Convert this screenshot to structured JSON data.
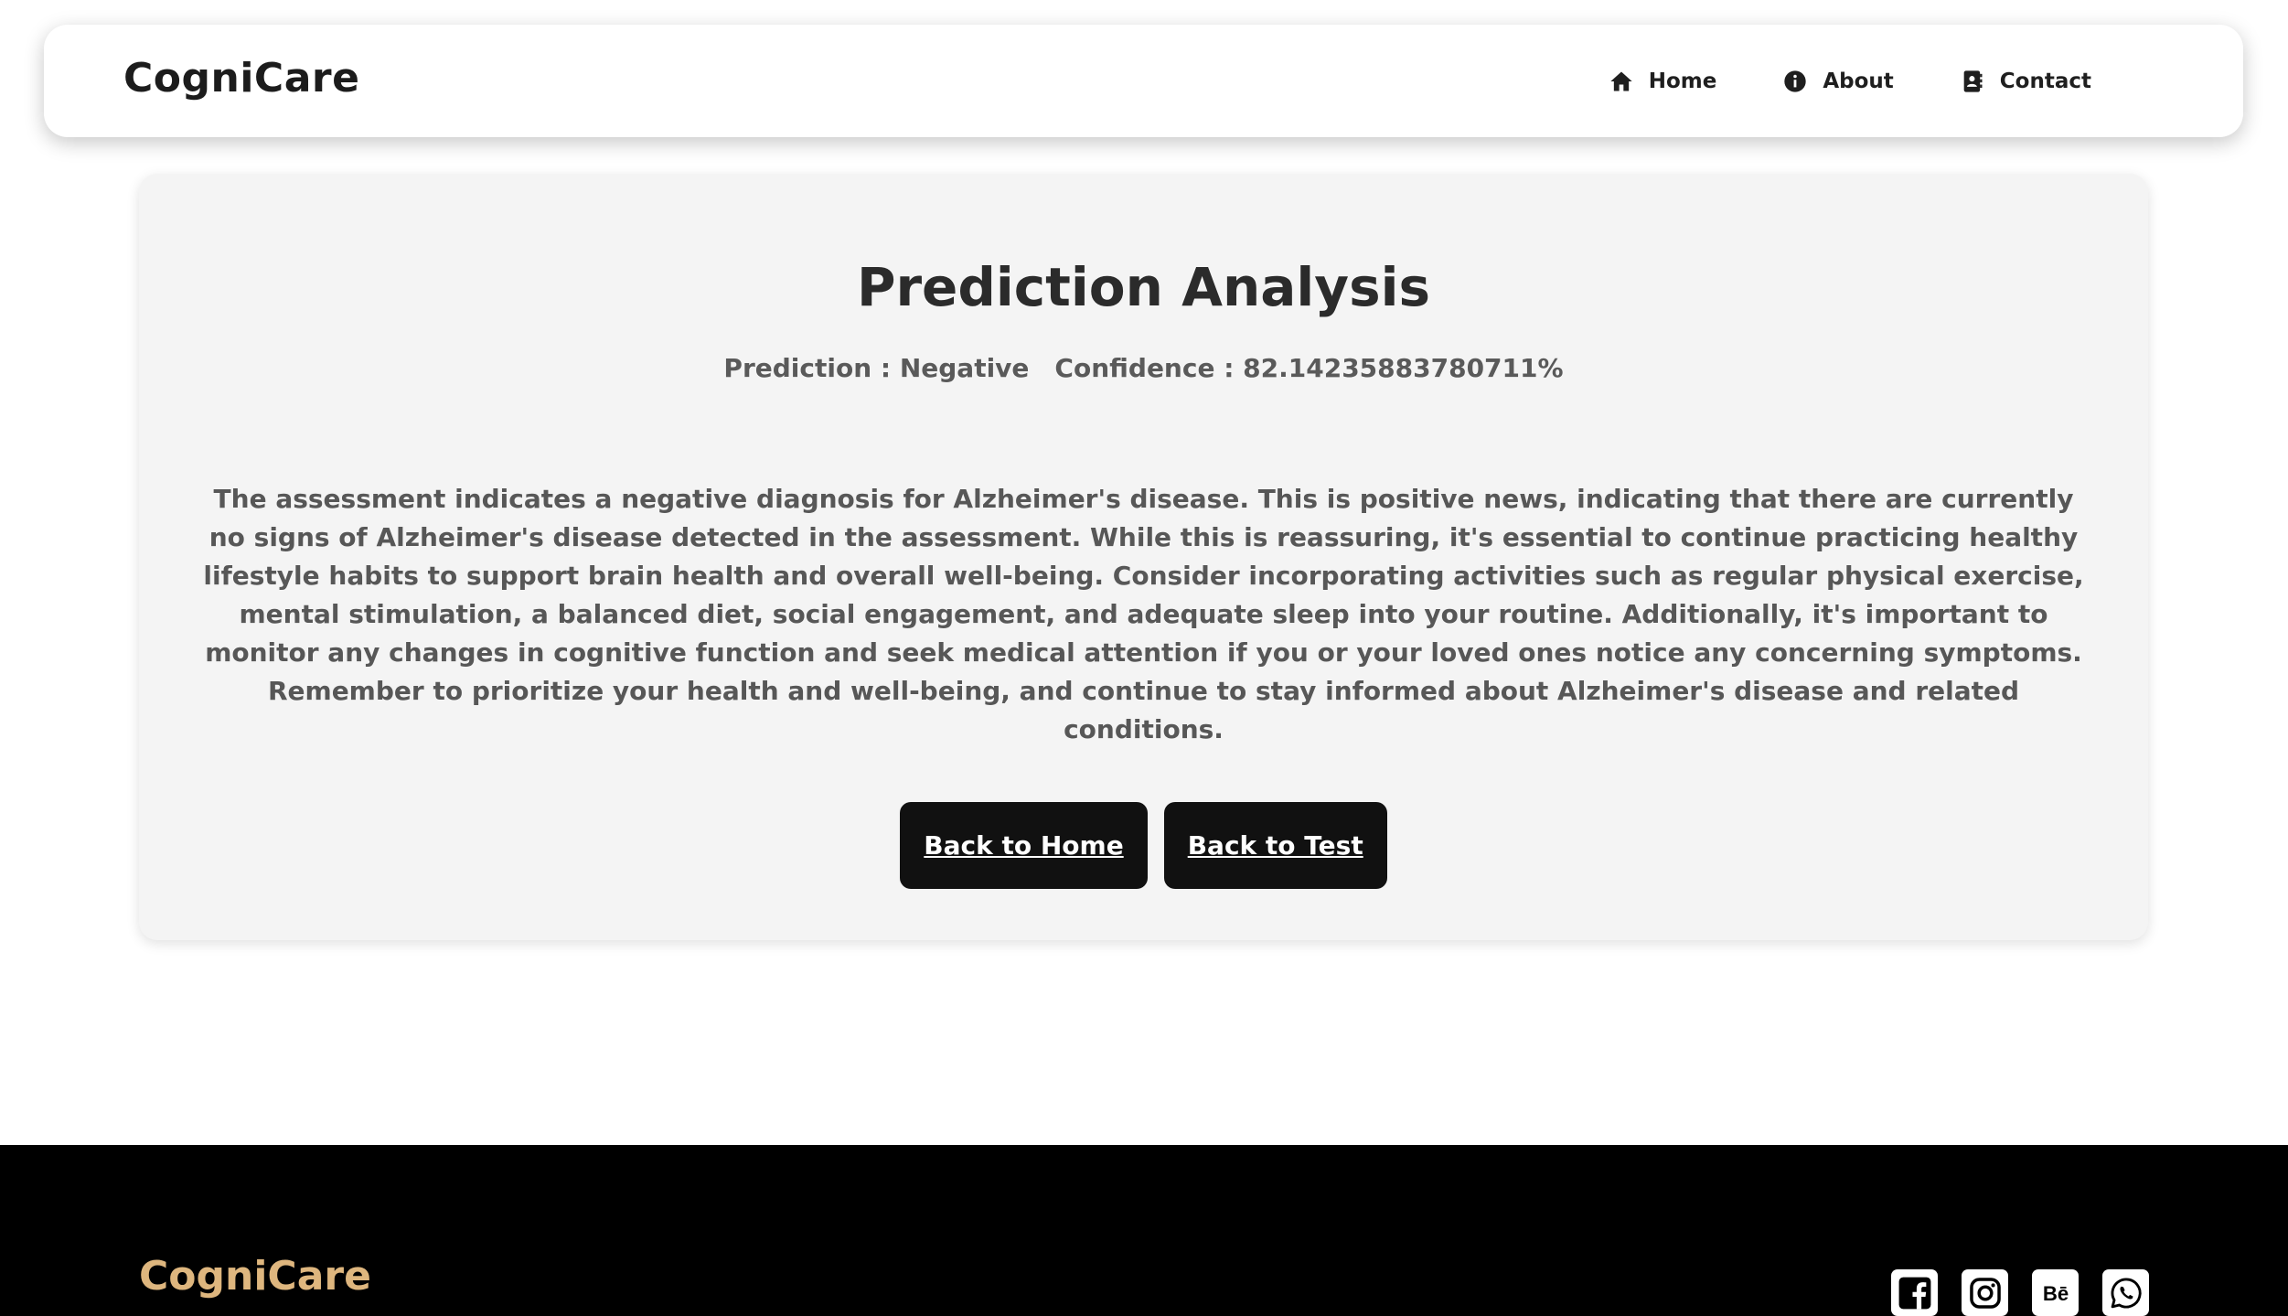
{
  "header": {
    "brand": "CogniCare",
    "nav": [
      {
        "label": "Home",
        "icon": "home-icon"
      },
      {
        "label": "About",
        "icon": "info-icon"
      },
      {
        "label": "Contact",
        "icon": "contact-card-icon"
      }
    ]
  },
  "result": {
    "title": "Prediction Analysis",
    "prediction_text": "Prediction : Negative",
    "confidence_text": "Confidence : 82.14235883780711%",
    "description": "The assessment indicates a negative diagnosis for Alzheimer's disease. This is positive news, indicating that there are currently no signs of Alzheimer's disease detected in the assessment. While this is reassuring, it's essential to continue practicing healthy lifestyle habits to support brain health and overall well-being. Consider incorporating activities such as regular physical exercise, mental stimulation, a balanced diet, social engagement, and adequate sleep into your routine. Additionally, it's important to monitor any changes in cognitive function and seek medical attention if you or your loved ones notice any concerning symptoms. Remember to prioritize your health and well-being, and continue to stay informed about Alzheimer's disease and related conditions.",
    "buttons": {
      "back_home": "Back to Home",
      "back_test": "Back to Test"
    }
  },
  "footer": {
    "brand": "CogniCare",
    "socials": [
      {
        "icon": "facebook-icon"
      },
      {
        "icon": "instagram-icon"
      },
      {
        "icon": "behance-icon",
        "text": "Bē"
      },
      {
        "icon": "whatsapp-icon"
      }
    ]
  },
  "colors": {
    "footer_brand": "#deb67e",
    "card_background": "#f4f4f4",
    "button_background": "#111111",
    "footer_background": "#000000"
  }
}
